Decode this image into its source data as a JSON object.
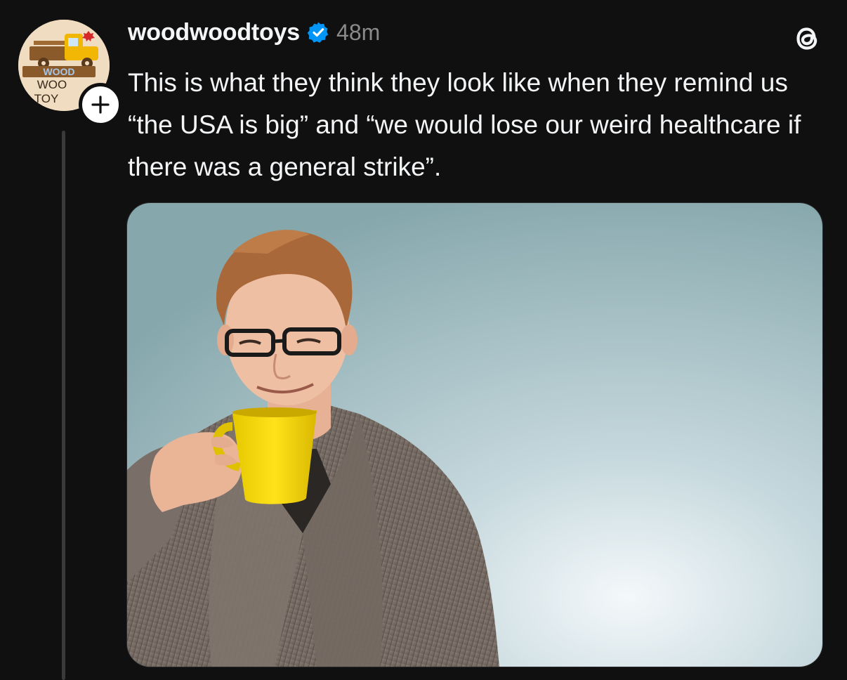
{
  "post": {
    "username": "woodwoodtoys",
    "timestamp": "48m",
    "text": "This is what they think they look like when they remind us “the USA is big” and “we would lose our weird healthcare if there was a general strike”.",
    "verified": true
  },
  "avatar": {
    "logo_text_top": "WOOD",
    "logo_text_mid": "WOO",
    "logo_text_bottom": "TOY"
  },
  "icons": {
    "verified": "verified-badge-icon",
    "follow": "plus-icon",
    "app": "threads-logo-icon"
  },
  "colors": {
    "background": "#101010",
    "text_primary": "#f3f5f7",
    "text_secondary": "#8a8a8a",
    "verified_blue": "#0095f6",
    "thread_line": "#3a3a3a"
  }
}
